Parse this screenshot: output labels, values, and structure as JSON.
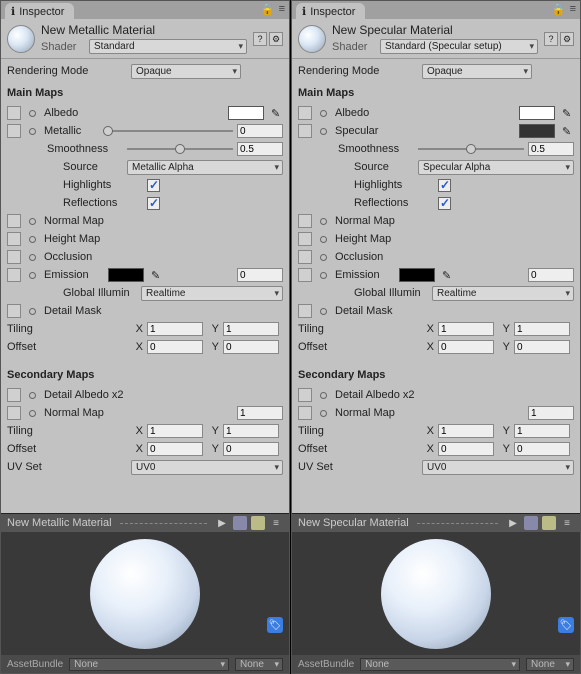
{
  "panels": [
    {
      "tab": "Inspector",
      "material_name": "New Metallic Material",
      "shader_label": "Shader",
      "shader_value": "Standard",
      "rendering_mode_label": "Rendering Mode",
      "rendering_mode_value": "Opaque",
      "main_maps_label": "Main Maps",
      "albedo_label": "Albedo",
      "albedo_color": "#ffffff",
      "spec_label": "Metallic",
      "spec_is_slider": true,
      "spec_value": "0",
      "spec_color": "",
      "smoothness_label": "Smoothness",
      "smoothness_value": "0.5",
      "smoothness_pos": "50%",
      "source_label": "Source",
      "source_value": "Metallic Alpha",
      "highlights_label": "Highlights",
      "highlights_on": true,
      "reflections_label": "Reflections",
      "reflections_on": true,
      "normal_label": "Normal Map",
      "height_label": "Height Map",
      "occlusion_label": "Occlusion",
      "emission_label": "Emission",
      "emission_num": "0",
      "gi_label": "Global Illumin",
      "gi_value": "Realtime",
      "detail_mask_label": "Detail Mask",
      "tiling_label": "Tiling",
      "tiling_x": "1",
      "tiling_y": "1",
      "offset_label": "Offset",
      "offset_x": "0",
      "offset_y": "0",
      "secondary_label": "Secondary Maps",
      "detail_albedo_label": "Detail Albedo x2",
      "sec_normal_label": "Normal Map",
      "sec_normal_value": "1",
      "sec_tiling_x": "1",
      "sec_tiling_y": "1",
      "sec_offset_x": "0",
      "sec_offset_y": "0",
      "uvset_label": "UV Set",
      "uvset_value": "UV0",
      "preview_name": "New Metallic Material",
      "assetbundle_label": "AssetBundle",
      "assetbundle_value": "None",
      "assetbundle_variant": "None"
    },
    {
      "tab": "Inspector",
      "material_name": "New Specular Material",
      "shader_label": "Shader",
      "shader_value": "Standard (Specular setup)",
      "rendering_mode_label": "Rendering Mode",
      "rendering_mode_value": "Opaque",
      "main_maps_label": "Main Maps",
      "albedo_label": "Albedo",
      "albedo_color": "#ffffff",
      "spec_label": "Specular",
      "spec_is_slider": false,
      "spec_value": "",
      "spec_color": "#333333",
      "smoothness_label": "Smoothness",
      "smoothness_value": "0.5",
      "smoothness_pos": "50%",
      "source_label": "Source",
      "source_value": "Specular Alpha",
      "highlights_label": "Highlights",
      "highlights_on": true,
      "reflections_label": "Reflections",
      "reflections_on": true,
      "normal_label": "Normal Map",
      "height_label": "Height Map",
      "occlusion_label": "Occlusion",
      "emission_label": "Emission",
      "emission_num": "0",
      "gi_label": "Global Illumin",
      "gi_value": "Realtime",
      "detail_mask_label": "Detail Mask",
      "tiling_label": "Tiling",
      "tiling_x": "1",
      "tiling_y": "1",
      "offset_label": "Offset",
      "offset_x": "0",
      "offset_y": "0",
      "secondary_label": "Secondary Maps",
      "detail_albedo_label": "Detail Albedo x2",
      "sec_normal_label": "Normal Map",
      "sec_normal_value": "1",
      "sec_tiling_x": "1",
      "sec_tiling_y": "1",
      "sec_offset_x": "0",
      "sec_offset_y": "0",
      "uvset_label": "UV Set",
      "uvset_value": "UV0",
      "preview_name": "New Specular Material",
      "assetbundle_label": "AssetBundle",
      "assetbundle_value": "None",
      "assetbundle_variant": "None"
    }
  ],
  "ui": {
    "x": "X",
    "y": "Y",
    "play": "▶",
    "lock": "🔒",
    "menu": "≡",
    "help": "?",
    "gear": "⚙"
  },
  "icons": {
    "info": "ℹ"
  }
}
